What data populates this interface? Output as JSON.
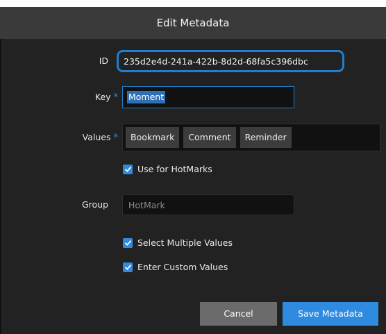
{
  "dialog": {
    "title": "Edit Metadata"
  },
  "fields": {
    "id": {
      "label": "ID",
      "value": "235d2e4d-241a-422b-8d2d-68fa5c396dbc"
    },
    "key": {
      "label": "Key",
      "required_mark": "*",
      "value": "Moment"
    },
    "values": {
      "label": "Values",
      "required_mark": "*",
      "items": [
        "Bookmark",
        "Comment",
        "Reminder"
      ]
    },
    "use_for_hotmarks": {
      "label": "Use for HotMarks",
      "checked": true
    },
    "group": {
      "label": "Group",
      "placeholder": "HotMark"
    },
    "select_multiple": {
      "label": "Select Multiple Values",
      "checked": true
    },
    "enter_custom": {
      "label": "Enter Custom Values",
      "checked": true
    }
  },
  "buttons": {
    "cancel": "Cancel",
    "save": "Save Metadata"
  },
  "colors": {
    "accent": "#2f8be0",
    "highlight_border": "#1e7fd0",
    "background": "#222222",
    "title_bar": "#3a3a3a",
    "cancel_button": "#6b6b6b"
  },
  "icons": {
    "checkbox": "checkmark-icon"
  }
}
